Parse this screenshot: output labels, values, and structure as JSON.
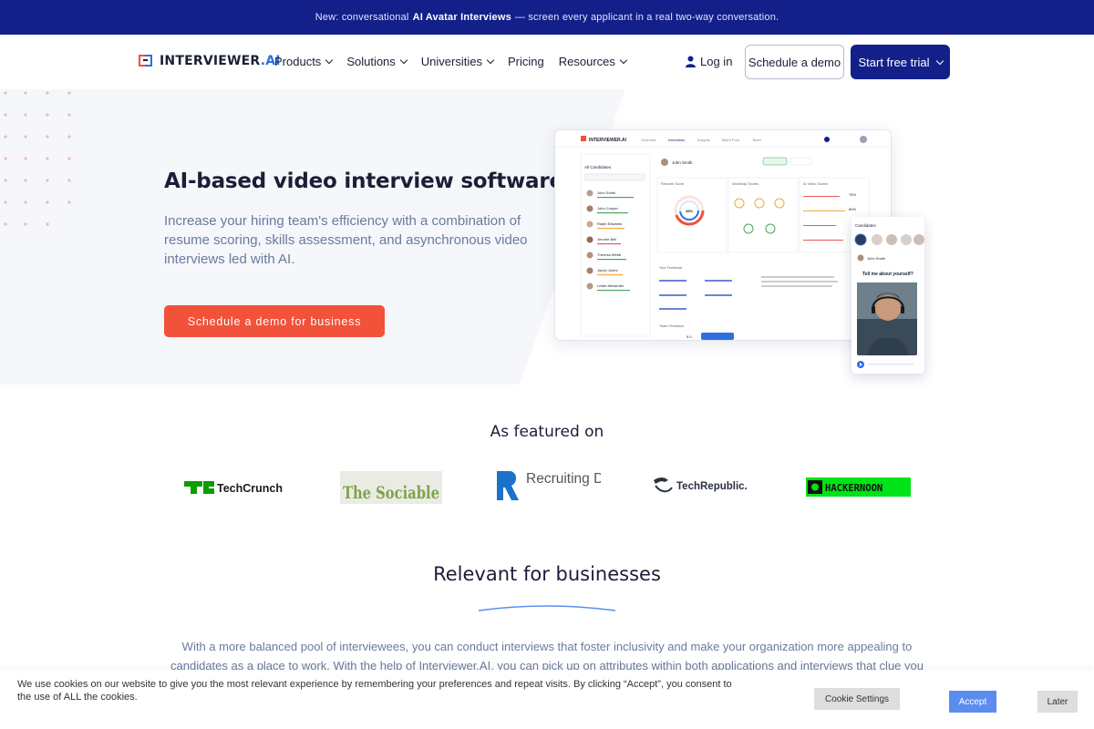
{
  "banner": {
    "prefix": "New: conversational",
    "bold": "AI Avatar Interviews",
    "suffix": "— screen every applicant in a real two-way conversation."
  },
  "nav": {
    "logo_main": "INTERVIEWER",
    "logo_suffix": ".AI",
    "menu": [
      "Products",
      "Solutions",
      "Universities",
      "Pricing",
      "Resources"
    ],
    "login": "Log in",
    "schedule_demo": "Schedule a demo",
    "start_trial": "Start free trial"
  },
  "hero": {
    "title": "AI-based video interview software",
    "subtitle": "Increase your hiring team's efficiency with a combination of resume scoring, skills assessment, and asynchronous video interviews led with AI.",
    "cta": "Schedule a demo for business"
  },
  "dashboard": {
    "logo": "INTERVIEWER.AI",
    "tabs": [
      "Overview",
      "Interviews",
      "Insights",
      "Talent Pool",
      "Team"
    ],
    "section": "All Candidates",
    "selected": "John Smith",
    "candidates": [
      "John Smith",
      "John Cooper",
      "Ralph Edwards",
      "Jerome Bell",
      "Theresa Webb",
      "Jacob Jones",
      "Leslie Alexander"
    ],
    "resume_score_label": "Resume Score",
    "resume_score": "45%",
    "workmap_label": "Workmap Scores",
    "ai_video_label": "AI Video Scores",
    "ai_pct_1": "75%",
    "ai_pct_2": "80%",
    "feedback_label": "Your Feedback",
    "team_feedback_label": "Team Feedback",
    "rating": "5.0"
  },
  "phone": {
    "header": "Candidates",
    "name": "John Smith",
    "question": "Tell me about yourself?"
  },
  "featured": {
    "title": "As featured on",
    "logos": [
      "TechCrunch",
      "The Sociable",
      "Recruiting Daily",
      "TechRepublic.",
      "HACKERNOON"
    ]
  },
  "relevant": {
    "title": "Relevant for businesses",
    "text": "With a more balanced pool of interviewees, you can conduct interviews that foster inclusivity and make your organization more appealing to candidates as a place to work. With the help of Interviewer.AI, you can pick up on attributes within both applications and interviews that clue you"
  },
  "cookie": {
    "text": "We use cookies on our website to give you the most relevant experience by remembering your preferences and repeat visits. By clicking “Accept”, you consent to the use of ALL the cookies.",
    "settings": "Cookie Settings",
    "accept": "Accept",
    "later": "Later"
  },
  "colors": {
    "navy": "#13208a",
    "coral": "#f2513a",
    "accent_blue": "#2f6fe0",
    "muted_text": "#6b7a9c"
  }
}
